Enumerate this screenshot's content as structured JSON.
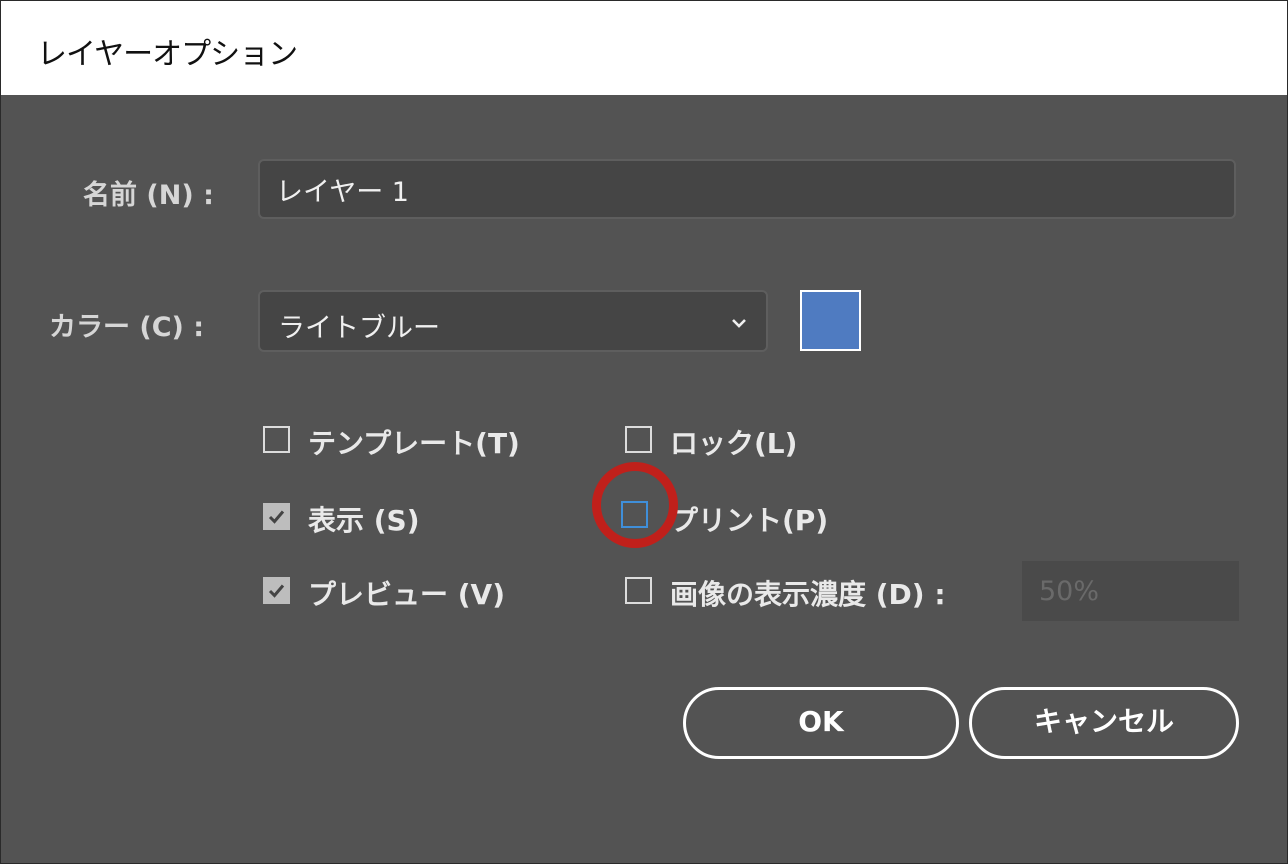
{
  "window": {
    "title": "レイヤーオプション"
  },
  "name": {
    "label": "名前 (N) :",
    "value": "レイヤー 1"
  },
  "color": {
    "label": "カラー (C) :",
    "selected": "ライトブルー",
    "swatch": "#4f7bc1"
  },
  "options": {
    "template": {
      "label": "テンプレート(T)",
      "checked": false
    },
    "lock": {
      "label": "ロック(L)",
      "checked": false
    },
    "show": {
      "label": "表示 (S)",
      "checked": true
    },
    "print": {
      "label": "プリント(P)",
      "checked": false
    },
    "preview": {
      "label": "プレビュー (V)",
      "checked": true
    },
    "dim": {
      "label": "画像の表示濃度 (D) :",
      "checked": false,
      "value": "50%"
    }
  },
  "buttons": {
    "ok": "OK",
    "cancel": "キャンセル"
  },
  "colors": {
    "background": "#535353",
    "annotation": "#c0201b",
    "focus": "#3f8fda"
  }
}
